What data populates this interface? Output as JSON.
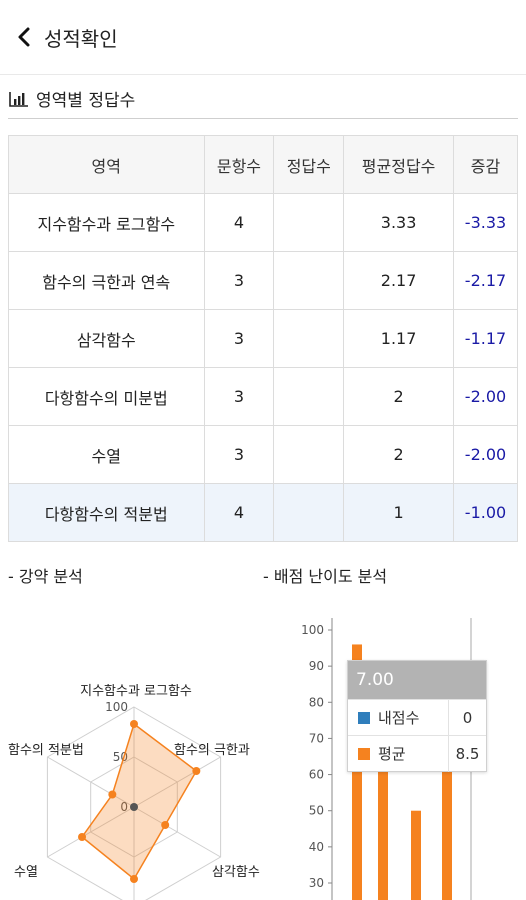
{
  "header": {
    "title": "성적확인"
  },
  "section": {
    "title": "영역별 정답수"
  },
  "table": {
    "headers": [
      "영역",
      "문항수",
      "정답수",
      "평균정답수",
      "증감"
    ],
    "rows": [
      {
        "area": "지수함수과 로그함수",
        "questions": "4",
        "correct": "",
        "avg": "3.33",
        "delta": "-3.33"
      },
      {
        "area": "함수의 극한과 연속",
        "questions": "3",
        "correct": "",
        "avg": "2.17",
        "delta": "-2.17"
      },
      {
        "area": "삼각함수",
        "questions": "3",
        "correct": "",
        "avg": "1.17",
        "delta": "-1.17"
      },
      {
        "area": "다항함수의 미분법",
        "questions": "3",
        "correct": "",
        "avg": "2",
        "delta": "-2.00"
      },
      {
        "area": "수열",
        "questions": "3",
        "correct": "",
        "avg": "2",
        "delta": "-2.00"
      },
      {
        "area": "다항함수의 적분법",
        "questions": "4",
        "correct": "",
        "avg": "1",
        "delta": "-1.00"
      }
    ]
  },
  "subsections": {
    "left": "- 강약 분석",
    "right": "- 배점 난이도 분석"
  },
  "colors": {
    "my_score": "#2f7ebc",
    "average": "#f5821f",
    "delta_text": "#1a1aa6"
  },
  "radar": {
    "axis_labels": [
      "지수함수과 로그함수",
      "함수의 극한과",
      "삼각함수",
      "",
      "수열",
      "함수의 적분법"
    ],
    "ring_labels": [
      "0",
      "50",
      "100"
    ],
    "values": [
      83,
      72,
      36,
      72,
      60,
      25
    ]
  },
  "bars": {
    "y_ticks": [
      "100",
      "90",
      "80",
      "70",
      "60",
      "50",
      "40",
      "30"
    ],
    "ylim": [
      25,
      100
    ],
    "values": [
      96,
      87,
      50,
      70
    ]
  },
  "tooltip": {
    "title": "7.00",
    "rows": [
      {
        "label": "내점수",
        "value": "0"
      },
      {
        "label": "평균",
        "value": "8.5"
      }
    ]
  }
}
